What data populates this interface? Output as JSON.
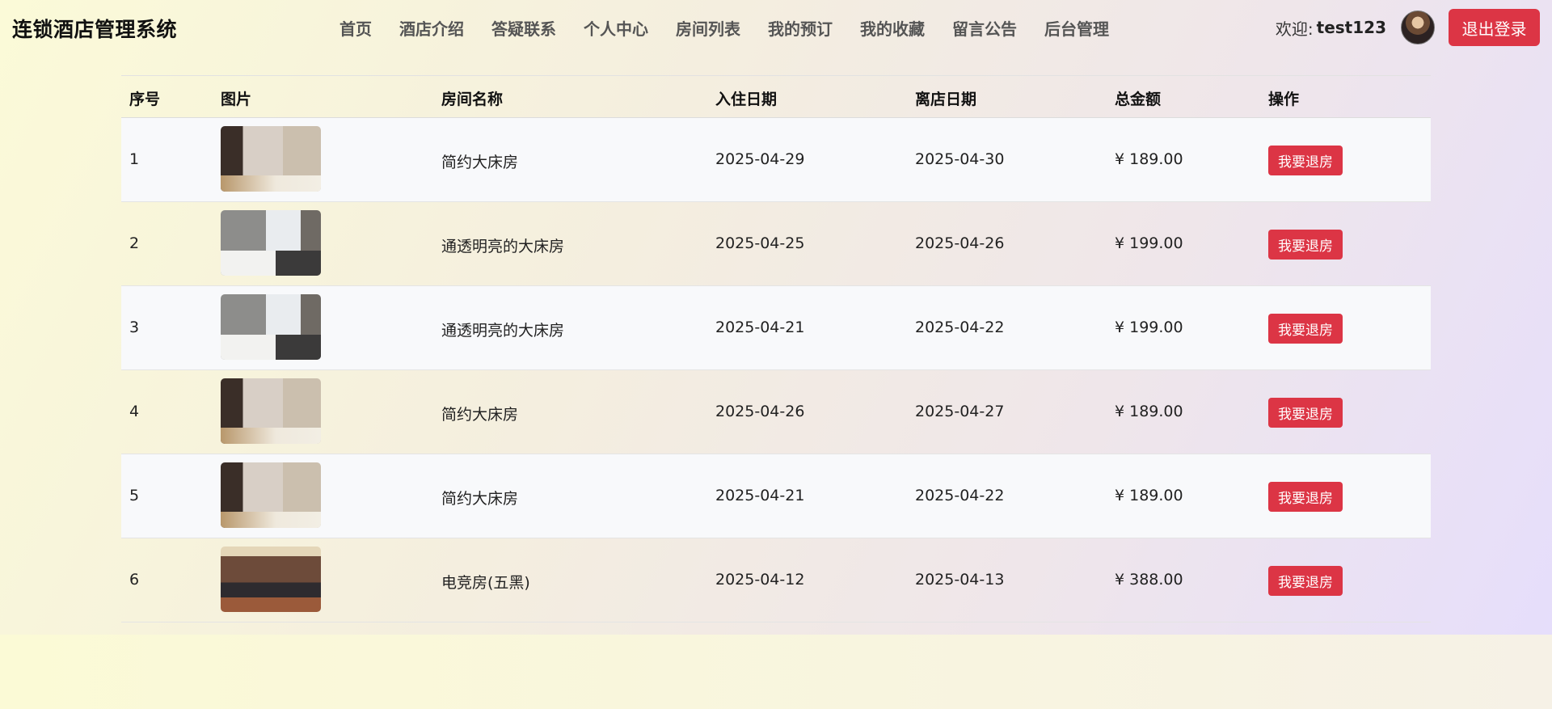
{
  "header": {
    "brand": "连锁酒店管理系统",
    "nav": [
      "首页",
      "酒店介绍",
      "答疑联系",
      "个人中心",
      "房间列表",
      "我的预订",
      "我的收藏",
      "留言公告",
      "后台管理"
    ],
    "welcome": "欢迎:",
    "username": "test123",
    "logout_label": "退出登录"
  },
  "table": {
    "columns": [
      "序号",
      "图片",
      "房间名称",
      "入住日期",
      "离店日期",
      "总金额",
      "操作"
    ],
    "rows": [
      {
        "index": "1",
        "image": "room-a",
        "name": "简约大床房",
        "checkin": "2025-04-29",
        "checkout": "2025-04-30",
        "total": "¥ 189.00",
        "action": "我要退房"
      },
      {
        "index": "2",
        "image": "room-b",
        "name": "通透明亮的大床房",
        "checkin": "2025-04-25",
        "checkout": "2025-04-26",
        "total": "¥ 199.00",
        "action": "我要退房"
      },
      {
        "index": "3",
        "image": "room-b",
        "name": "通透明亮的大床房",
        "checkin": "2025-04-21",
        "checkout": "2025-04-22",
        "total": "¥ 199.00",
        "action": "我要退房"
      },
      {
        "index": "4",
        "image": "room-a",
        "name": "简约大床房",
        "checkin": "2025-04-26",
        "checkout": "2025-04-27",
        "total": "¥ 189.00",
        "action": "我要退房"
      },
      {
        "index": "5",
        "image": "room-a",
        "name": "简约大床房",
        "checkin": "2025-04-21",
        "checkout": "2025-04-22",
        "total": "¥ 189.00",
        "action": "我要退房"
      },
      {
        "index": "6",
        "image": "room-c",
        "name": "电竞房(五黑)",
        "checkin": "2025-04-12",
        "checkout": "2025-04-13",
        "total": "¥ 388.00",
        "action": "我要退房"
      }
    ]
  },
  "colors": {
    "danger": "#dc3545"
  }
}
